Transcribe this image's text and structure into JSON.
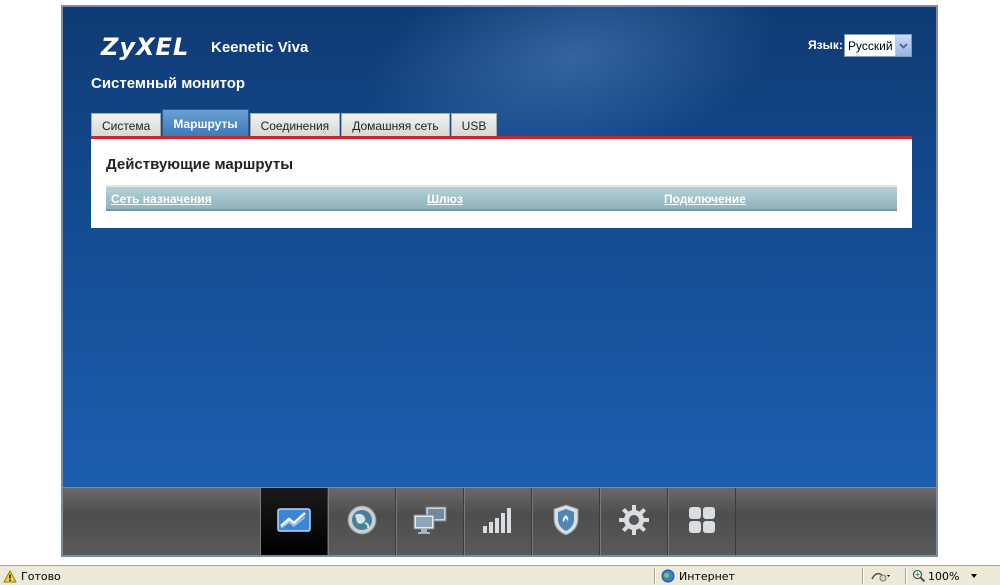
{
  "header": {
    "brand": "ZyXEL",
    "model": "Keenetic Viva",
    "language_label": "Язык:",
    "language_value": "Русский"
  },
  "page": {
    "title": "Системный монитор"
  },
  "tabs": [
    {
      "label": "Система",
      "active": false
    },
    {
      "label": "Маршруты",
      "active": true
    },
    {
      "label": "Соединения",
      "active": false
    },
    {
      "label": "Домашняя сеть",
      "active": false
    },
    {
      "label": "USB",
      "active": false
    }
  ],
  "routes": {
    "heading": "Действующие маршруты",
    "columns": [
      "Сеть назначения",
      "Шлюз",
      "Подключение"
    ]
  },
  "dock": [
    {
      "icon": "monitor-chart-icon",
      "active": true
    },
    {
      "icon": "globe-icon",
      "active": false
    },
    {
      "icon": "home-network-icon",
      "active": false
    },
    {
      "icon": "wifi-signal-icon",
      "active": false
    },
    {
      "icon": "security-shield-icon",
      "active": false
    },
    {
      "icon": "gear-icon",
      "active": false
    },
    {
      "icon": "apps-grid-icon",
      "active": false
    }
  ],
  "statusbar": {
    "status_text": "Готово",
    "zone": "Интернет",
    "zoom": "100%"
  },
  "colors": {
    "accent_red": "#c52a2f",
    "tab_active": "#3a78b8",
    "background_blue": "#134a8e"
  }
}
